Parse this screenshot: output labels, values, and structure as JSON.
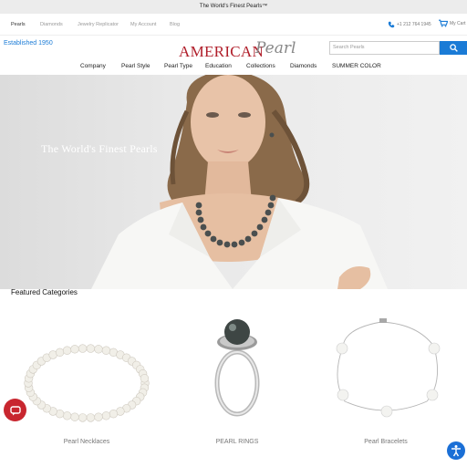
{
  "topbar": {
    "text": "The World's Finest Pearls™"
  },
  "subnav": {
    "links": [
      "Pearls",
      "Diamonds",
      "Jewelry Replicator",
      "My Account",
      "Blog"
    ],
    "phone": "+1 212 764 1945",
    "cart": "My Cart"
  },
  "header": {
    "established": "Established 1950",
    "logo_main": "AMERICAN",
    "logo_script": "Pearl",
    "search_placeholder": "Search Pearls"
  },
  "mainnav": {
    "items": [
      "Company",
      "Pearl Style",
      "Pearl Type",
      "Education",
      "Collections",
      "Diamonds",
      "SUMMER COLOR"
    ]
  },
  "hero": {
    "headline": "The World's Finest Pearls"
  },
  "featured": {
    "title": "Featured Categories",
    "categories": [
      "Pearl Necklaces",
      "PEARL RINGS",
      "Pearl Bracelets"
    ]
  },
  "colors": {
    "accent": "#1a7bd6",
    "brand": "#b01e2a",
    "chat": "#c8262f"
  },
  "icons": [
    "phone-icon",
    "cart-icon",
    "search-icon",
    "chat-icon",
    "accessibility-icon"
  ]
}
